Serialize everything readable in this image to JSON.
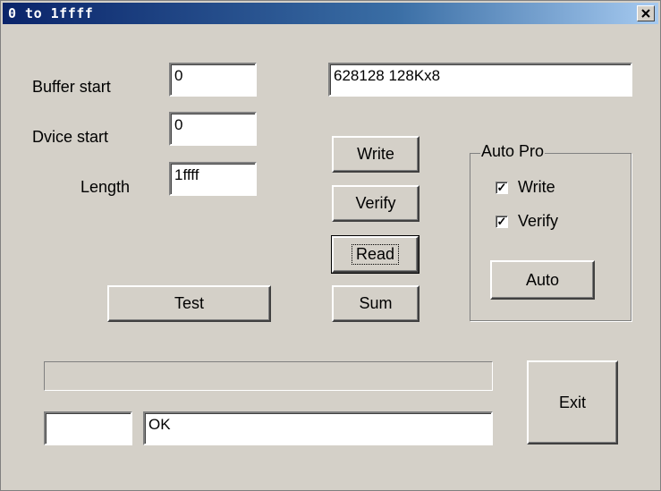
{
  "window": {
    "title": "0 to 1ffff"
  },
  "fields": {
    "buffer_start": {
      "label": "Buffer start",
      "value": "0"
    },
    "device_start": {
      "label": "Dvice start",
      "value": "0"
    },
    "length": {
      "label": "Length",
      "value": "1ffff"
    },
    "chip_info": {
      "value": "628128 128Kx8"
    }
  },
  "buttons": {
    "write": "Write",
    "verify": "Verify",
    "read": "Read",
    "sum": "Sum",
    "test": "Test",
    "auto": "Auto",
    "exit": "Exit"
  },
  "auto_pro": {
    "legend": "Auto Pro",
    "write": {
      "label": "Write",
      "checked": true
    },
    "verify": {
      "label": "Verify",
      "checked": true
    }
  },
  "status": {
    "progress": 0,
    "left_value": "",
    "message": "OK"
  }
}
